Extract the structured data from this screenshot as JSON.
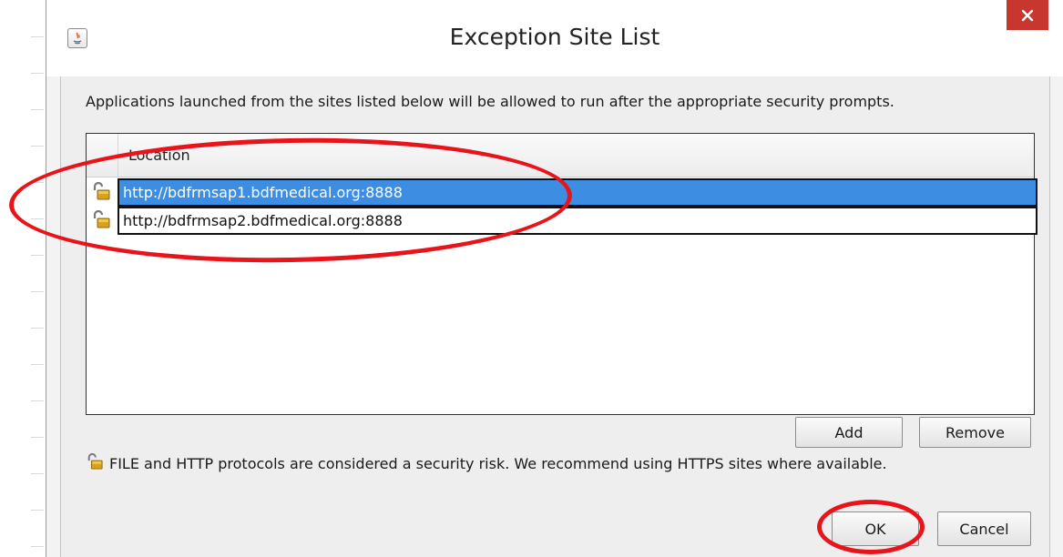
{
  "window": {
    "title": "Exception Site List",
    "close_glyph": "✕"
  },
  "description": "Applications launched from the sites listed below will be allowed to run after the appropriate security prompts.",
  "table": {
    "column_header": "Location",
    "rows": [
      {
        "url": "http://bdfrmsap1.bdfmedical.org:8888",
        "selected": true,
        "icon": "unlocked-padlock-icon"
      },
      {
        "url": "http://bdfrmsap2.bdfmedical.org:8888",
        "selected": false,
        "icon": "unlocked-padlock-icon"
      }
    ]
  },
  "table_buttons": {
    "add_label": "Add",
    "remove_label": "Remove"
  },
  "warning": {
    "icon": "unlocked-padlock-icon",
    "text": "FILE and HTTP protocols are considered a security risk.  We recommend using HTTPS sites where available."
  },
  "footer": {
    "ok_label": "OK",
    "cancel_label": "Cancel"
  },
  "colors": {
    "selection": "#3d8ee3",
    "close_button": "#c7372f",
    "annotation": "#e8141a"
  }
}
